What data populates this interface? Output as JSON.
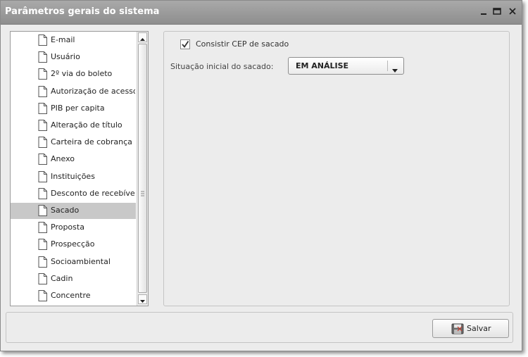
{
  "window": {
    "title": "Parâmetros gerais do sistema"
  },
  "tree": {
    "items": [
      {
        "label": "E-mail"
      },
      {
        "label": "Usuário"
      },
      {
        "label": "2º via do boleto"
      },
      {
        "label": "Autorização de acesso"
      },
      {
        "label": "PIB per capita"
      },
      {
        "label": "Alteração de título"
      },
      {
        "label": "Carteira de cobrança"
      },
      {
        "label": "Anexo"
      },
      {
        "label": "Instituições"
      },
      {
        "label": "Desconto de recebíveis"
      },
      {
        "label": "Sacado",
        "selected": true
      },
      {
        "label": "Proposta"
      },
      {
        "label": "Prospecção"
      },
      {
        "label": "Socioambiental"
      },
      {
        "label": "Cadin"
      },
      {
        "label": "Concentre"
      }
    ]
  },
  "form": {
    "checkbox_label": "Consistir CEP de sacado",
    "checkbox_checked": true,
    "situacao_label": "Situação inicial do sacado:",
    "situacao_value": "EM ANÁLISE"
  },
  "footer": {
    "save_label": "Salvar"
  },
  "icons": {
    "minimize": "minimize-icon",
    "maximize": "maximize-icon",
    "close": "close-icon",
    "document": "document-icon",
    "save": "floppy-icon"
  },
  "colors": {
    "titlebar": "#9a9a9a",
    "selected_row": "#c8c8c8",
    "panel_bg": "#ececec"
  }
}
